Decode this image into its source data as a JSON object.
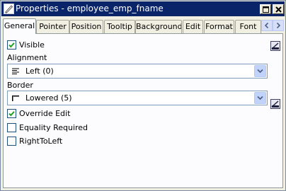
{
  "window": {
    "title": "Properties - employee_emp_fname",
    "title_color": "#0a246a"
  },
  "tabs": [
    {
      "label": "General",
      "active": true
    },
    {
      "label": "Pointer"
    },
    {
      "label": "Position"
    },
    {
      "label": "Tooltip"
    },
    {
      "label": "Background"
    },
    {
      "label": "Edit"
    },
    {
      "label": "Format"
    },
    {
      "label": "Font"
    }
  ],
  "general": {
    "visible": {
      "label": "Visible",
      "checked": true
    },
    "alignment": {
      "label": "Alignment",
      "value": "Left (0)"
    },
    "border": {
      "label": "Border",
      "value": "Lowered (5)"
    },
    "override_edit": {
      "label": "Override Edit",
      "checked": true
    },
    "equality_required": {
      "label": "Equality Required",
      "checked": false
    },
    "right_to_left": {
      "label": "RightToLeft",
      "checked": false
    }
  },
  "icons": {
    "tab_scroll_left": "chevron-left-icon",
    "tab_scroll_right": "chevron-right-icon",
    "expression_button": "expression-icon"
  }
}
